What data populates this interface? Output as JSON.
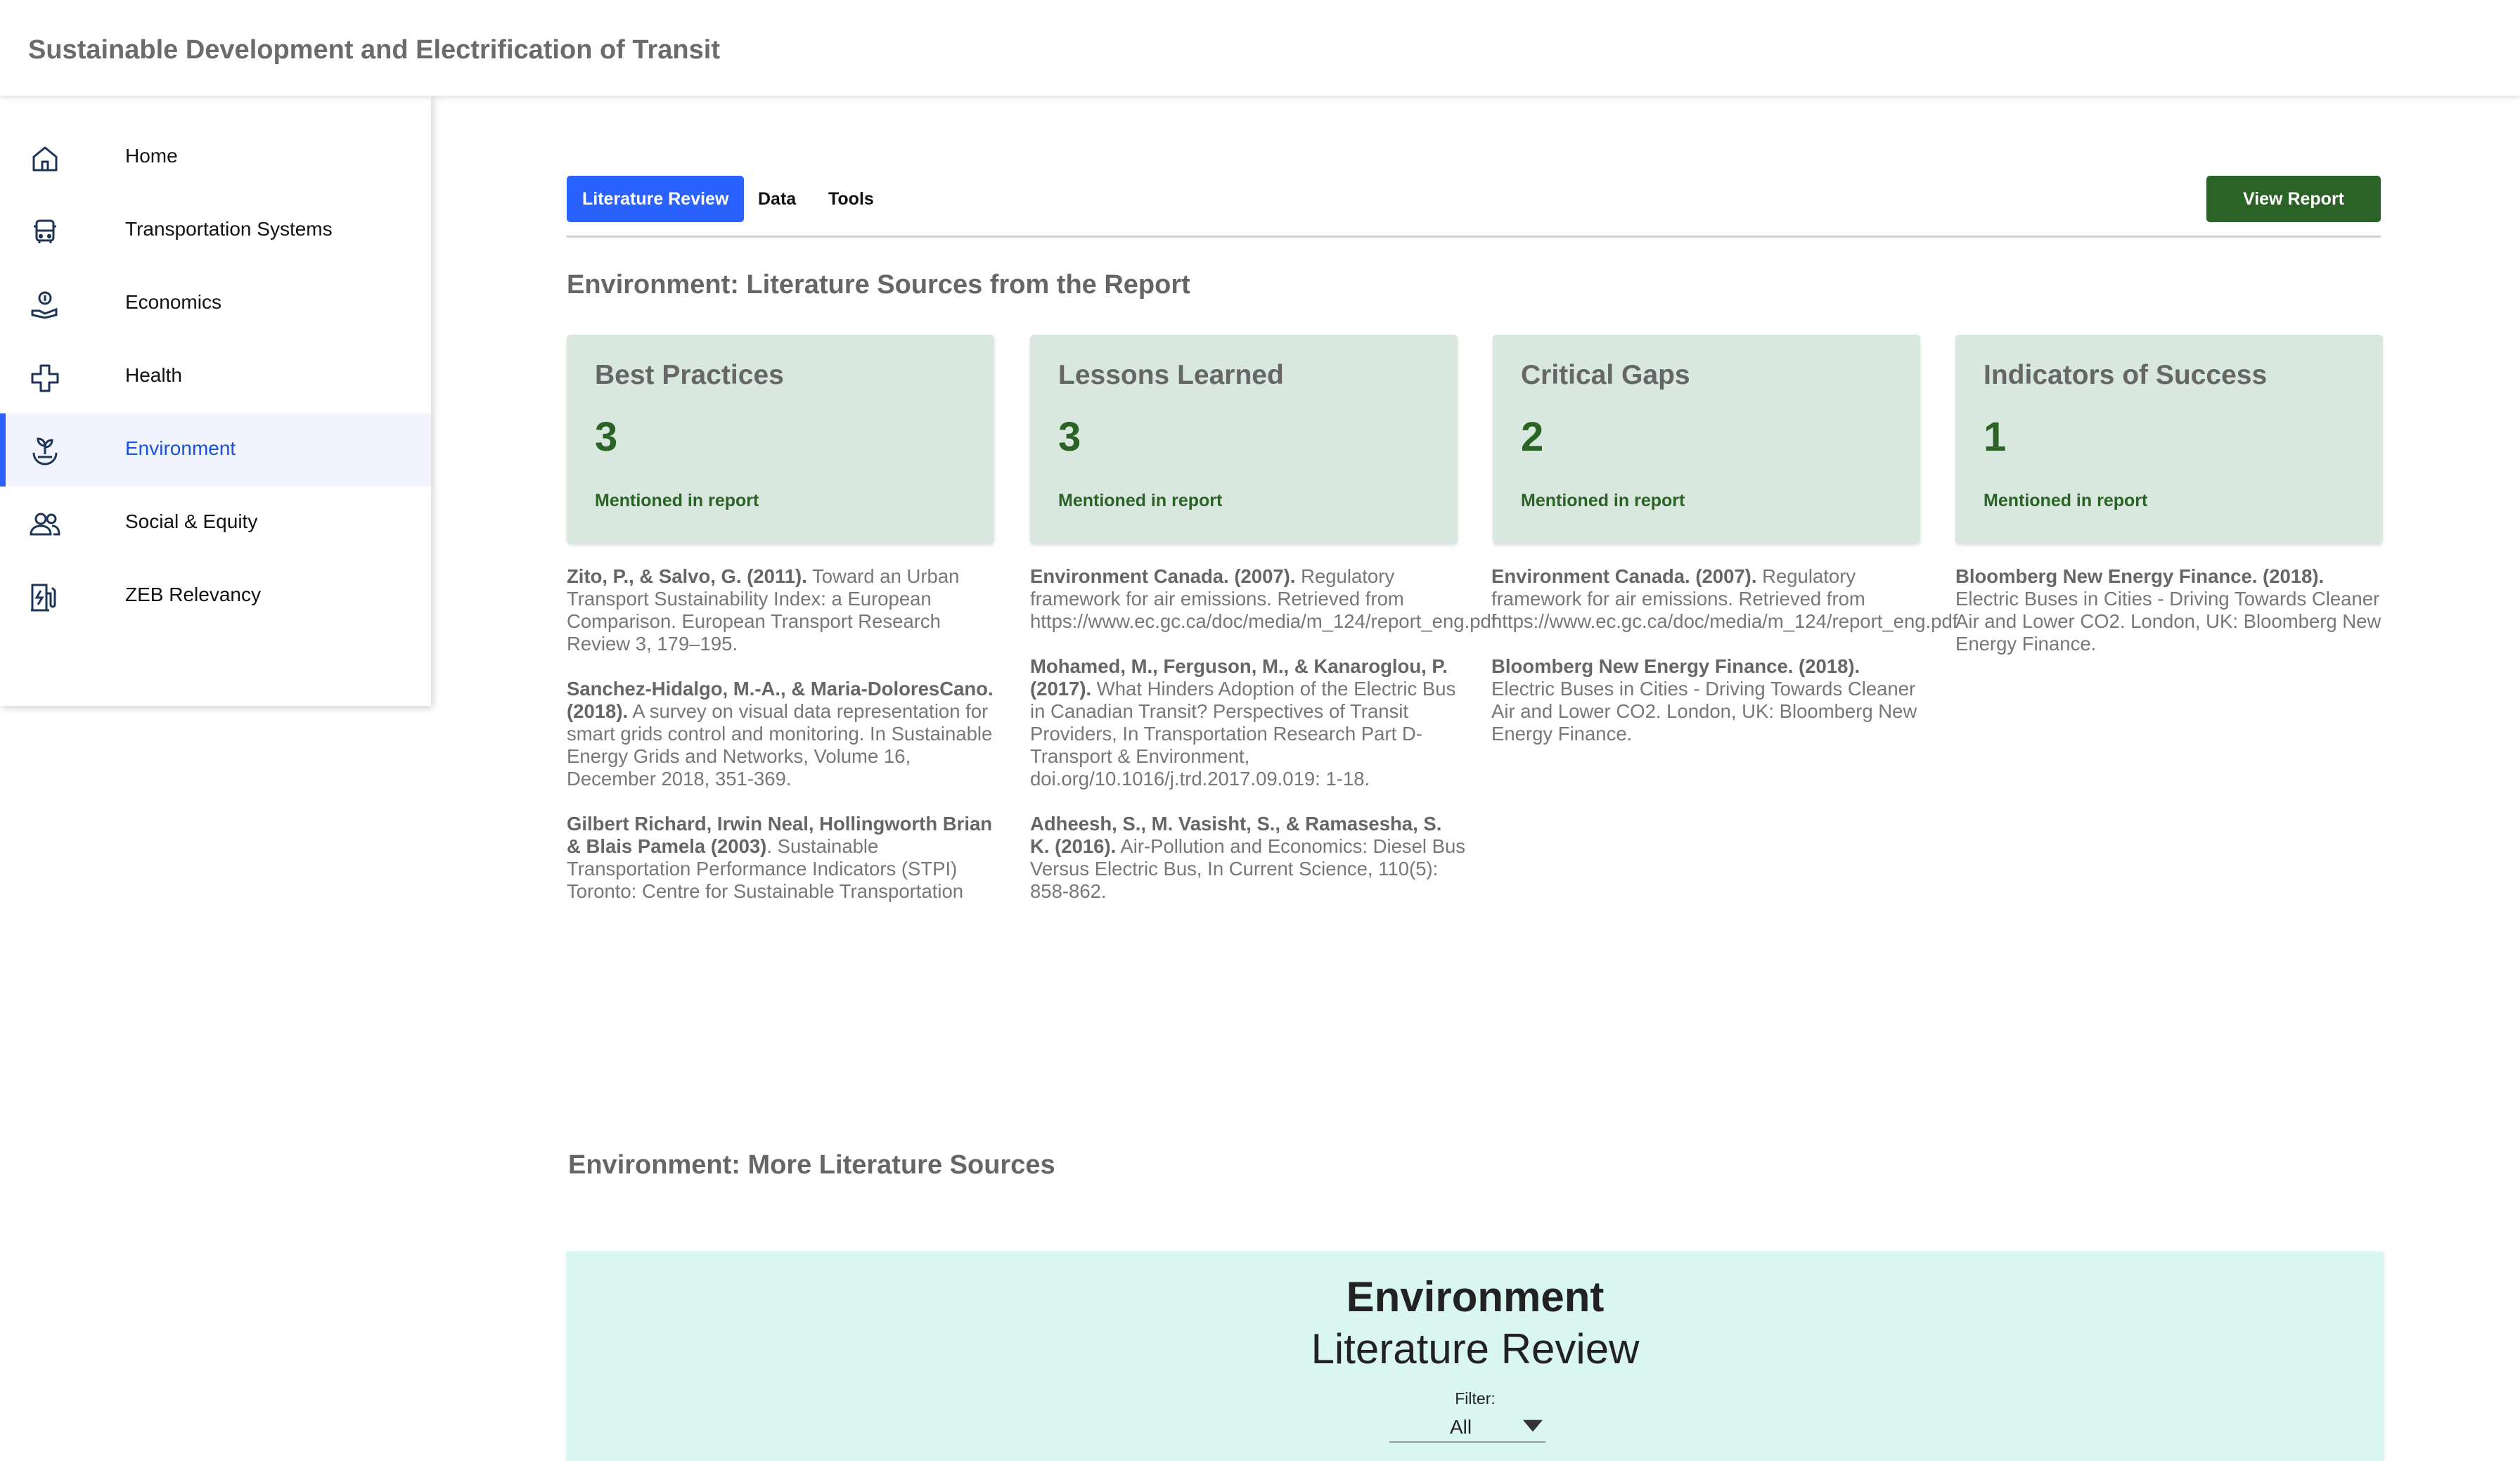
{
  "header": {
    "title": "Sustainable Development and Electrification of Transit"
  },
  "sidebar": {
    "items": [
      {
        "label": "Home",
        "icon": "home-icon"
      },
      {
        "label": "Transportation Systems",
        "icon": "bus-icon"
      },
      {
        "label": "Economics",
        "icon": "hand-money-icon"
      },
      {
        "label": "Health",
        "icon": "health-cross-icon"
      },
      {
        "label": "Environment",
        "icon": "plant-hand-icon",
        "active": true
      },
      {
        "label": "Social & Equity",
        "icon": "people-icon"
      },
      {
        "label": "ZEB Relevancy",
        "icon": "ev-charger-icon"
      }
    ]
  },
  "tabs": {
    "items": [
      {
        "label": "Literature Review",
        "active": true
      },
      {
        "label": "Data"
      },
      {
        "label": "Tools"
      }
    ],
    "view_report": "View Report"
  },
  "sections": {
    "report_sources": "Environment: Literature Sources from the Report",
    "more_sources": "Environment: More Literature Sources"
  },
  "cards": [
    {
      "title": "Best Practices",
      "count": "3",
      "subtitle": "Mentioned in report"
    },
    {
      "title": "Lessons Learned",
      "count": "3",
      "subtitle": "Mentioned in report"
    },
    {
      "title": "Critical Gaps",
      "count": "2",
      "subtitle": "Mentioned in report"
    },
    {
      "title": "Indicators of Success",
      "count": "1",
      "subtitle": "Mentioned in report"
    }
  ],
  "references": {
    "best_practices": [
      {
        "authors": "Zito, P., & Salvo, G. (2011).",
        "text": " Toward an Urban Transport Sustainability Index: a European Comparison. European Transport Research Review 3, 179–195."
      },
      {
        "authors": "Sanchez-Hidalgo, M.-A., & Maria-DoloresCano. (2018).",
        "text": " A survey on visual data representation for smart grids control and monitoring. In Sustainable Energy Grids and Networks, Volume 16, December 2018, 351-369."
      },
      {
        "authors": "Gilbert Richard, Irwin Neal, Hollingworth Brian & Blais Pamela (2003)",
        "text": ". Sustainable Transportation Performance Indicators (STPI) Toronto: Centre for Sustainable Transportation"
      }
    ],
    "lessons_learned": [
      {
        "authors": "Environment Canada. (2007).",
        "text": " Regulatory framework for air emissions. Retrieved from",
        "url": "https://www.ec.gc.ca/doc/media/m_124/report_eng.pdf"
      },
      {
        "authors": "Mohamed, M., Ferguson, M., & Kanaroglou, P. (2017).",
        "text": " What Hinders Adoption of the Electric Bus in Canadian Transit? Perspectives of Transit Providers, In Transportation Research Part D-Transport & Environment, doi.org/10.1016/j.trd.2017.09.019: 1-18."
      },
      {
        "authors": "Adheesh, S., M. Vasisht, S., & Ramasesha, S. K. (2016).",
        "text": " Air-Pollution and Economics: Diesel Bus Versus Electric Bus, In Current Science, 110(5): 858-862."
      }
    ],
    "critical_gaps": [
      {
        "authors": "Environment Canada. (2007).",
        "text": " Regulatory framework for air emissions. Retrieved from",
        "url": "https://www.ec.gc.ca/doc/media/m_124/report_eng.pdf"
      },
      {
        "authors": "Bloomberg New Energy Finance. (2018).",
        "text": " Electric Buses in Cities - Driving Towards Cleaner Air and Lower CO2. London, UK: Bloomberg New Energy Finance."
      }
    ],
    "indicators": [
      {
        "authors": "Bloomberg New Energy Finance. (2018).",
        "text": " Electric Buses in Cities - Driving Towards Cleaner Air and Lower CO2. London, UK: Bloomberg New Energy Finance."
      }
    ]
  },
  "literature_box": {
    "title": "Environment",
    "subtitle": "Literature Review",
    "filter_label": "Filter:",
    "filter_value": "All"
  },
  "colors": {
    "primary_blue": "#2962ff",
    "report_green": "#2b6226",
    "card_bg": "#d8e8df",
    "lit_bg": "#d9f6f0"
  }
}
